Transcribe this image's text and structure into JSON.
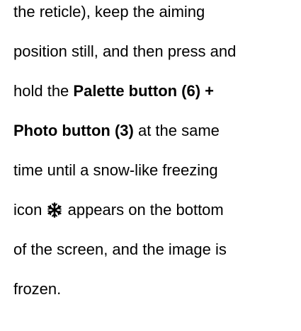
{
  "paragraph": {
    "l1": "the reticle), keep the aiming",
    "l2": "position still, and then press and",
    "l3a": "hold the ",
    "l3b": "Palette button (6) +",
    "l4a": "Photo button (3)",
    "l4b": " at the same",
    "l5": "time until a snow-like freezing",
    "l6a": "icon ",
    "l6b": " appears on the bottom",
    "l7": "of the screen, and the image is",
    "l8": "frozen."
  },
  "icons": {
    "freeze": "snowflake-icon"
  },
  "colors": {
    "text": "#000000",
    "background": "#ffffff"
  }
}
